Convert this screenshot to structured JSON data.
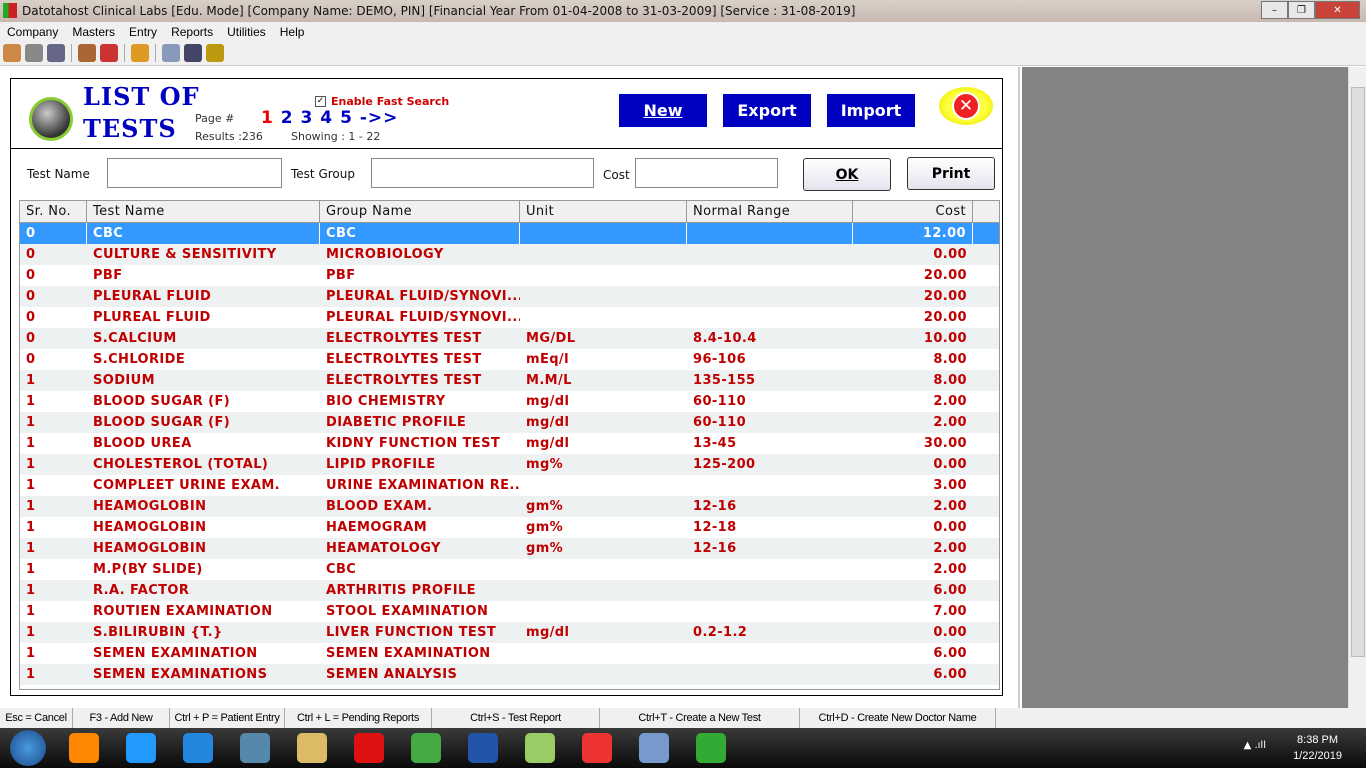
{
  "window": {
    "title": "Datotahost Clinical Labs [Edu. Mode] [Company Name: DEMO, PIN] [Financial Year From 01-04-2008 to 31-03-2009]  [Service : 31-08-2019]",
    "minimize": "–",
    "maximize": "❐",
    "close": "✕"
  },
  "menu": [
    "Company",
    "Masters",
    "Entry",
    "Reports",
    "Utilities",
    "Help"
  ],
  "toolbar_icons": [
    "users-icon",
    "copy-icon",
    "install-icon",
    "bottles-icon",
    "tools-icon",
    "shapes-icon",
    "calculator-icon",
    "calendar-icon",
    "books-icon"
  ],
  "header": {
    "title_line1": "LIST OF",
    "title_line2": "TESTS",
    "page_label": "Page #",
    "pages": [
      "1",
      "2",
      "3",
      "4",
      "5"
    ],
    "current_page": "1",
    "next": "->>",
    "results": "Results :236",
    "showing": "Showing :  1 - 22",
    "fast_search_label": "Enable Fast Search",
    "fast_search_checked": true,
    "check": "✓"
  },
  "buttons": {
    "new": "New",
    "export": "Export",
    "import": "Import",
    "close": "✕",
    "ok": "OK",
    "print": "Print"
  },
  "filters": {
    "test_name_label": "Test Name",
    "test_group_label": "Test Group",
    "cost_label": "Cost",
    "test_name": "",
    "test_group": "",
    "cost": ""
  },
  "table": {
    "columns": [
      "Sr. No.",
      "Test Name",
      "Group Name",
      "Unit",
      "Normal Range",
      "Cost"
    ],
    "rows": [
      [
        "0",
        "CBC",
        "CBC",
        "",
        "",
        "12.00"
      ],
      [
        "0",
        "CULTURE & SENSITIVITY",
        "MICROBIOLOGY",
        "",
        "",
        "0.00"
      ],
      [
        "0",
        "PBF",
        "PBF",
        "",
        "",
        "20.00"
      ],
      [
        "0",
        "PLEURAL FLUID",
        "PLEURAL FLUID/SYNOVI...",
        "",
        "",
        "20.00"
      ],
      [
        "0",
        "PLUREAL FLUID",
        "PLEURAL FLUID/SYNOVI...",
        "",
        "",
        "20.00"
      ],
      [
        "0",
        "S.CALCIUM",
        "ELECTROLYTES TEST",
        "MG/DL",
        "8.4-10.4",
        "10.00"
      ],
      [
        "0",
        "S.CHLORIDE",
        "ELECTROLYTES TEST",
        "mEq/l",
        "96-106",
        "8.00"
      ],
      [
        "1",
        " SODIUM",
        "ELECTROLYTES TEST",
        "M.M/L",
        "135-155",
        "8.00"
      ],
      [
        "1",
        "BLOOD SUGAR (F)",
        "BIO CHEMISTRY",
        "mg/dl",
        "60-110",
        "2.00"
      ],
      [
        "1",
        "BLOOD SUGAR (F)",
        "DIABETIC PROFILE",
        "mg/dl",
        "60-110",
        "2.00"
      ],
      [
        "1",
        "BLOOD UREA",
        "KIDNY FUNCTION TEST",
        "mg/dl",
        "13-45",
        "30.00"
      ],
      [
        "1",
        "CHOLESTEROL (TOTAL)",
        "LIPID PROFILE",
        "mg%",
        "125-200",
        "0.00"
      ],
      [
        "1",
        "COMPLEET URINE EXAM.",
        "URINE EXAMINATION RE...",
        "",
        "",
        "3.00"
      ],
      [
        "1",
        "HEAMOGLOBIN",
        "BLOOD EXAM.",
        "gm%",
        "12-16",
        "2.00"
      ],
      [
        "1",
        "HEAMOGLOBIN",
        "HAEMOGRAM",
        "gm%",
        "12-18",
        "0.00"
      ],
      [
        "1",
        "HEAMOGLOBIN",
        "HEAMATOLOGY",
        "gm%",
        "12-16",
        "2.00"
      ],
      [
        "1",
        "M.P(BY SLIDE)",
        "CBC",
        "",
        "",
        "2.00"
      ],
      [
        "1",
        "R.A. FACTOR",
        "ARTHRITIS PROFILE",
        "",
        "",
        "6.00"
      ],
      [
        "1",
        "ROUTIEN EXAMINATION",
        "STOOL EXAMINATION",
        "",
        "",
        "7.00"
      ],
      [
        "1",
        "S.BILIRUBIN {T.}",
        "LIVER FUNCTION TEST",
        "mg/dl",
        "0.2-1.2",
        "0.00"
      ],
      [
        "1",
        "SEMEN EXAMINATION",
        "SEMEN EXAMINATION",
        "",
        "",
        "6.00"
      ],
      [
        "1",
        "SEMEN EXAMINATIONS",
        "SEMEN ANALYSIS",
        "",
        "",
        "6.00"
      ]
    ]
  },
  "statusbar": [
    "Esc = Cancel",
    "F3 - Add New",
    "Ctrl + P = Patient Entry",
    "Ctrl + L = Pending Reports",
    "Ctrl+S - Test Report",
    "Ctrl+T -  Create a New Test",
    "Ctrl+D - Create New Doctor Name"
  ],
  "taskbar": {
    "apps": [
      "vlc",
      "screenshot",
      "internet-explorer",
      "control-panel",
      "file-explorer",
      "opera",
      "chrome",
      "word",
      "sticky-notes",
      "anydesk",
      "paint",
      "clinical-labs"
    ],
    "time": "8:38 PM",
    "date": "1/22/2019",
    "tray": "▲ .ıll"
  },
  "colors": {
    "accent_blue": "#0000c0",
    "row_text": "#c00000",
    "selected_row": "#3399ff"
  }
}
